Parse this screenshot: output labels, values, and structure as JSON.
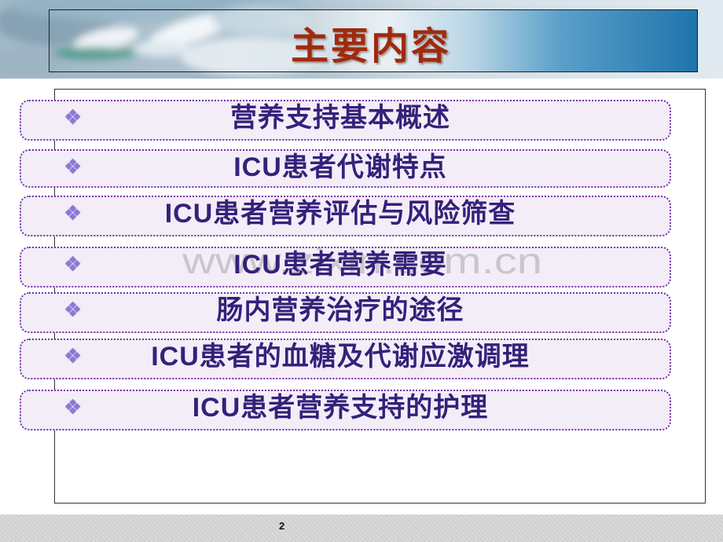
{
  "slide": {
    "title": "主要内容",
    "page_number": "2",
    "watermark": "www.zixin.com.cn"
  },
  "items": [
    {
      "label": "营养支持基本概述"
    },
    {
      "label": "ICU患者代谢特点"
    },
    {
      "label": "ICU患者营养评估与风险筛查"
    },
    {
      "label": "ICU患者营养需要"
    },
    {
      "label": "肠内营养治疗的途径"
    },
    {
      "label": "ICU患者的血糖及代谢应激调理"
    },
    {
      "label": "ICU患者营养支持的护理"
    }
  ],
  "icons": {
    "bullet": "diamond-bullet-icon",
    "header_image": "surgery-photo"
  },
  "colors": {
    "title": "#a02a0d",
    "item_text": "#33217a",
    "item_border": "#7a2fa8",
    "item_fill": "#f3edf8",
    "bullet": "#8a79d8",
    "header_accent": "#1f74ad",
    "footer_bg": "#d6d6d6"
  }
}
